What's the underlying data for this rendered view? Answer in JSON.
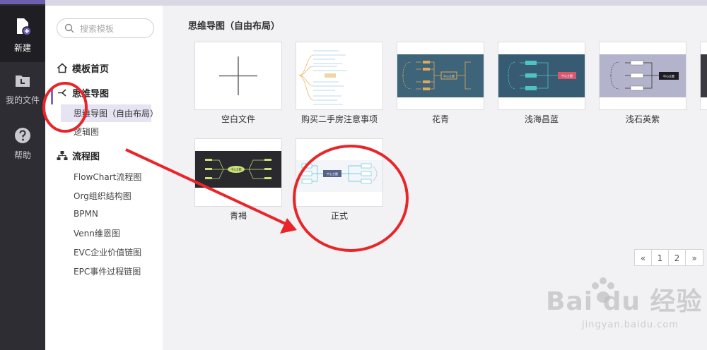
{
  "rail": {
    "items": [
      {
        "label": "新建"
      },
      {
        "label": "我的文件"
      },
      {
        "label": "帮助"
      }
    ]
  },
  "sidebar": {
    "search_placeholder": "搜索模板",
    "home_label": "模板首页",
    "mindmap_label": "思维导图",
    "mindmap_items": [
      "思维导图（自由布局）",
      "逻辑图"
    ],
    "flow_label": "流程图",
    "flow_items": [
      "FlowChart流程图",
      "Org组织结构图",
      "BPMN",
      "Venn维恩图",
      "EVC企业价值链图",
      "EPC事件过程链图"
    ]
  },
  "main": {
    "section_title": "思维导图（自由布局）",
    "templates": [
      {
        "name": "空白文件"
      },
      {
        "name": "购买二手房注意事项"
      },
      {
        "name": "花青"
      },
      {
        "name": "浅海昌蓝"
      },
      {
        "name": "浅石英紫"
      },
      {
        "name": "青褐"
      },
      {
        "name": "正式"
      }
    ],
    "thumb_center_label": "中心主题",
    "pager": {
      "prev": "«",
      "pages": [
        "1",
        "2"
      ],
      "next": "»"
    }
  },
  "watermark": {
    "brand": "Bai du 经验",
    "url": "jingyan.baidu.com"
  },
  "colors": {
    "rail_bg": "#2e2d33",
    "accent": "#7a6cc4",
    "annotation_red": "#e8262a",
    "huaqing_bg": "#3d6478",
    "qianhai_bg": "#365b73",
    "qianshi_bg": "#b4b3cc",
    "qinghe_bg": "#2a2a2e"
  }
}
